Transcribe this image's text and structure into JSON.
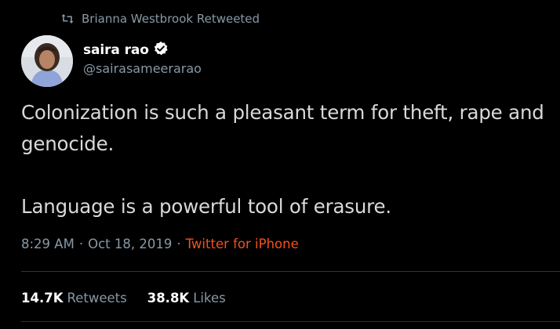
{
  "retweet": {
    "icon": "retweet-icon",
    "text": "Brianna Westbrook Retweeted"
  },
  "author": {
    "name": "saira rao",
    "handle": "@sairasameerarao",
    "verified_icon": "verified-badge-icon"
  },
  "tweet": {
    "paragraph1": "Colonization is such a pleasant term for theft, rape and genocide.",
    "paragraph2": "Language is a powerful tool of erasure."
  },
  "meta": {
    "time": "8:29 AM",
    "separator": "·",
    "date": "Oct 18, 2019",
    "source": "Twitter for iPhone",
    "source_color": "#f4511e"
  },
  "stats": {
    "retweets_count": "14.7K",
    "retweets_label": "Retweets",
    "likes_count": "38.8K",
    "likes_label": "Likes"
  },
  "colors": {
    "background": "#000000",
    "muted_text": "#8899a6",
    "primary_text": "#d9d9d9"
  }
}
